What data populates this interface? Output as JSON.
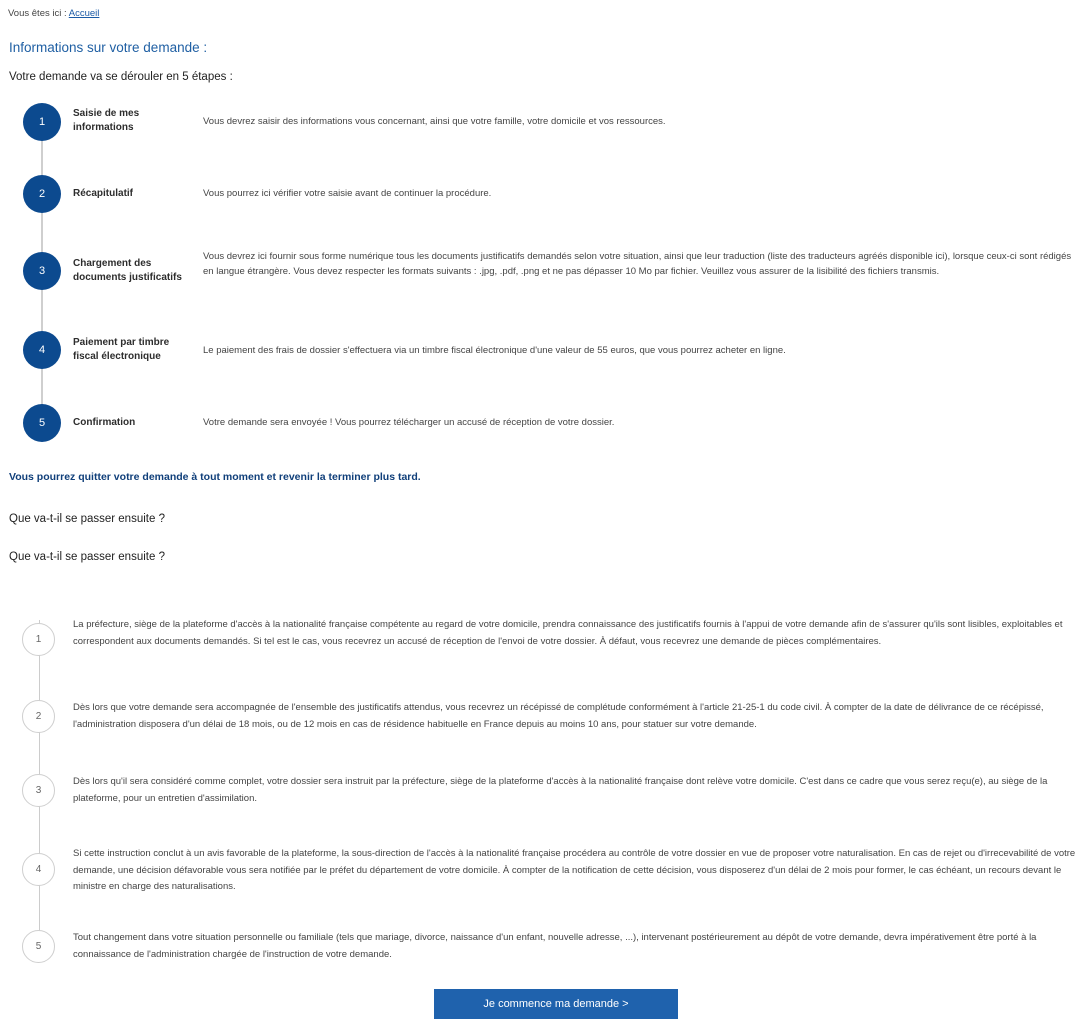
{
  "breadcrumb": {
    "prefix": "Vous êtes ici :",
    "link": "Accueil"
  },
  "section_title": "Informations sur votre demande :",
  "steps_intro": "Votre demande va se dérouler en 5 étapes :",
  "steps": [
    {
      "number": "1",
      "title": "Saisie de mes informations",
      "description": "Vous devrez saisir des informations vous concernant, ainsi que votre famille, votre domicile et vos ressources."
    },
    {
      "number": "2",
      "title": "Récapitulatif",
      "description": "Vous pourrez ici vérifier votre saisie avant de continuer la procédure."
    },
    {
      "number": "3",
      "title": "Chargement des documents justificatifs",
      "description": "Vous devrez ici fournir sous forme numérique tous les documents justificatifs demandés selon votre situation, ainsi que leur traduction (liste des traducteurs agréés disponible ici), lorsque ceux-ci sont rédigés en langue étrangère. Vous devez respecter les formats suivants : .jpg, .pdf, .png et ne pas dépasser 10 Mo par fichier. Veuillez vous assurer de la lisibilité des fichiers transmis."
    },
    {
      "number": "4",
      "title": "Paiement par timbre fiscal électronique",
      "description": "Le paiement des frais de dossier s'effectuera via un timbre fiscal électronique d'une valeur de 55 euros, que vous pourrez acheter en ligne."
    },
    {
      "number": "5",
      "title": "Confirmation",
      "description": "Votre demande sera envoyée ! Vous pourrez télécharger un accusé de réception de votre dossier."
    }
  ],
  "notice": "Vous pourrez quitter votre demande à tout moment et revenir la terminer plus tard.",
  "next_heading_1": "Que va-t-il se passer ensuite ?",
  "next_heading_2": "Que va-t-il se passer ensuite ?",
  "next_steps": [
    {
      "number": "1",
      "description": "La préfecture, siège de la plateforme d'accès à la nationalité française compétente au regard de votre domicile, prendra connaissance des justificatifs fournis à l'appui de votre demande afin de s'assurer qu'ils sont lisibles, exploitables et correspondent aux documents demandés. Si tel est le cas, vous recevrez un accusé de réception de l'envoi de votre dossier. À défaut, vous recevrez une demande de pièces complémentaires."
    },
    {
      "number": "2",
      "description": "Dès lors que votre demande sera accompagnée de l'ensemble des justificatifs attendus, vous recevrez un récépissé de complétude conformément à l'article 21-25-1 du code civil. À compter de la date de délivrance de ce récépissé, l'administration disposera d'un délai de 18 mois, ou de 12 mois en cas de résidence habituelle en France depuis au moins 10 ans, pour statuer sur votre demande."
    },
    {
      "number": "3",
      "description": "Dès lors qu'il sera considéré comme complet, votre dossier sera instruit par la préfecture, siège de la plateforme d'accès à la nationalité française dont relève votre domicile. C'est dans ce cadre que vous serez reçu(e), au siège de la plateforme, pour un entretien d'assimilation."
    },
    {
      "number": "4",
      "description": "Si cette instruction conclut à un avis favorable de la plateforme, la sous-direction de l'accès à la nationalité française procédera au contrôle de votre dossier en vue de proposer votre naturalisation. En cas de rejet ou d'irrecevabilité de votre demande, une décision défavorable vous sera notifiée par le préfet du département de votre domicile. À compter de la notification de cette décision, vous disposerez d'un délai de 2 mois pour former, le cas échéant, un recours devant le ministre en charge des naturalisations."
    },
    {
      "number": "5",
      "description": "Tout changement dans votre situation personnelle ou familiale (tels que mariage, divorce, naissance d'un enfant, nouvelle adresse, ...), intervenant postérieurement au dépôt de votre demande, devra impérativement être porté à la connaissance de l'administration chargée de l'instruction de votre demande."
    }
  ],
  "cta_label": "Je commence ma demande >"
}
